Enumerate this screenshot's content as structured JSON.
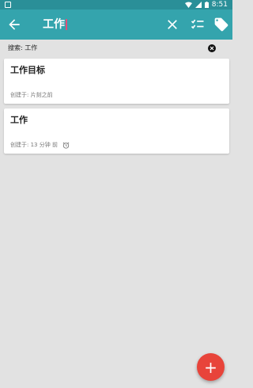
{
  "status_bar": {
    "time": "8:51"
  },
  "toolbar": {
    "search_query": "工作",
    "back_icon": "arrow-left-icon",
    "actions": [
      "close-icon",
      "checklist-icon",
      "tag-icon"
    ]
  },
  "search_filter": {
    "label": "搜索: 工作",
    "clear_icon": "circle-x-icon"
  },
  "notes": [
    {
      "title": "工作目标",
      "created": "创建于: 片刻之前",
      "has_reminder": false
    },
    {
      "title": "工作",
      "created": "创建于: 13 分钟 前",
      "has_reminder": true
    }
  ],
  "fab": {
    "label": "+",
    "icon": "plus-icon"
  },
  "colors": {
    "status_bar": "#2a8f98",
    "app_bar": "#34a4ad",
    "fab": "#e8443a",
    "background": "#e2e2e2"
  }
}
